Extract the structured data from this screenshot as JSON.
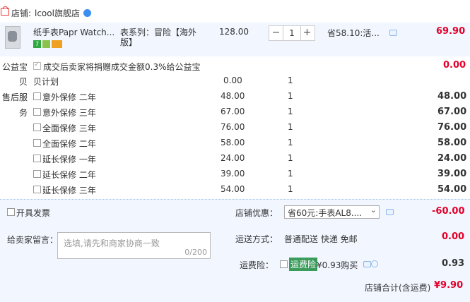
{
  "shop": {
    "label": "店铺:",
    "name": "lcool旗舰店"
  },
  "item": {
    "title": "纸手表Papr Watch...",
    "badges": [
      {
        "text": "7",
        "color": "#2fa83f"
      },
      {
        "text": "",
        "color": "#8bc34a"
      },
      {
        "text": "",
        "color": "#f0a020"
      }
    ],
    "attr": "表系列：冒险【海外版】",
    "attr_line1": "表系列：冒险【海外",
    "attr_line2": "版】",
    "unit_price": "128.00",
    "qty_minus": "−",
    "qty": "1",
    "qty_plus": "+",
    "promo": "省58.10:活...",
    "subtotal": "69.90"
  },
  "charity": {
    "label": "公益宝",
    "text": "成交后卖家将捐赠成交金额0.3%给公益宝",
    "amount": "0.00"
  },
  "installment": {
    "label": "贝",
    "name": "贝计划",
    "price": "0.00",
    "qty": "1"
  },
  "after_sales": {
    "label_line1": "售后服",
    "label_line2": "务",
    "options": [
      {
        "name": "意外保修 二年",
        "price": "48.00",
        "qty": "1",
        "total": "48.00"
      },
      {
        "name": "意外保修 三年",
        "price": "67.00",
        "qty": "1",
        "total": "67.00"
      },
      {
        "name": "全面保修 三年",
        "price": "76.00",
        "qty": "1",
        "total": "76.00"
      },
      {
        "name": "全面保修 二年",
        "price": "58.00",
        "qty": "1",
        "total": "58.00"
      },
      {
        "name": "延长保修 一年",
        "price": "24.00",
        "qty": "1",
        "total": "24.00"
      },
      {
        "name": "延长保修 二年",
        "price": "39.00",
        "qty": "1",
        "total": "39.00"
      },
      {
        "name": "延长保修 三年",
        "price": "54.00",
        "qty": "1",
        "total": "54.00"
      }
    ]
  },
  "invoice": {
    "label": "开具发票"
  },
  "discount": {
    "label": "店铺优惠：",
    "selected": "省60元:手表AL8....",
    "amount": "-60.00"
  },
  "message": {
    "label": "给卖家留言：",
    "placeholder": "选填,请先和商家协商一致",
    "counter": "0/200"
  },
  "shipping": {
    "label": "运送方式：",
    "value": "普通配送 快递 免邮",
    "amount": "0.00"
  },
  "freight_insurance": {
    "label": "运费险：",
    "tag": "运费险",
    "text": "¥0.93购买",
    "amount": "0.93"
  },
  "shop_total": {
    "label": "店铺合计(含运费)",
    "amount": "¥9.90"
  },
  "colors": {
    "accent_red": "#e4002b",
    "row_bg": "#f2f7ff",
    "link_blue": "#3a8ef0"
  }
}
